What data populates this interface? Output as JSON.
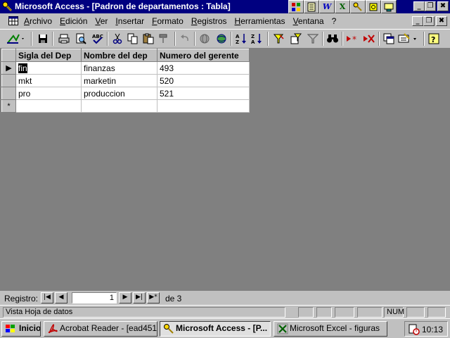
{
  "window": {
    "title": "Microsoft Access - [Padron de departamentos : Tabla]",
    "minimize_glyph": "_",
    "restore_glyph": "❐",
    "close_glyph": "✖"
  },
  "office_bar": [
    {
      "icon": "office-logo-icon"
    },
    {
      "icon": "notepad-icon"
    },
    {
      "icon": "word-icon",
      "glyph": "W"
    },
    {
      "icon": "excel-icon",
      "glyph": "X"
    },
    {
      "icon": "access-key-icon"
    },
    {
      "icon": "binder-icon"
    },
    {
      "icon": "outlook-icon"
    }
  ],
  "menu": {
    "items": [
      "Archivo",
      "Edición",
      "Ver",
      "Insertar",
      "Formato",
      "Registros",
      "Herramientas",
      "Ventana",
      "?"
    ]
  },
  "toolbar": [
    "design-view-icon",
    "save-icon",
    "print-icon",
    "print-preview-icon",
    "spelling-icon",
    "cut-icon",
    "copy-icon",
    "paste-icon",
    "format-painter-icon",
    "undo-icon",
    "insert-hyperlink-icon",
    "web-toolbar-icon",
    "sort-ascending-icon",
    "sort-descending-icon",
    "filter-by-selection-icon",
    "filter-by-form-icon",
    "apply-filter-icon",
    "find-icon",
    "new-record-icon",
    "delete-record-icon",
    "properties-icon",
    "database-window-icon",
    "new-object-icon",
    "help-icon"
  ],
  "table": {
    "columns": [
      "Sigla del Dep",
      "Nombre del dep",
      "Numero del gerente"
    ],
    "rows": [
      [
        "fin",
        "finanzas",
        "493"
      ],
      [
        "mkt",
        "marketin",
        "520"
      ],
      [
        "pro",
        "produccion",
        "521"
      ]
    ],
    "current_row_glyph": "▶",
    "new_row_glyph": "*"
  },
  "navigator": {
    "label": "Registro:",
    "current": "1",
    "of_label": "de 3",
    "first_glyph": "|◀",
    "prev_glyph": "◀",
    "next_glyph": "▶",
    "last_glyph": "▶|",
    "new_glyph": "▶*"
  },
  "status": {
    "text": "Vista Hoja de datos",
    "num": "NUM"
  },
  "taskbar": {
    "start": "Inicio",
    "tasks": [
      {
        "label": "Acrobat Reader - [ead451-...",
        "icon": "acrobat-icon"
      },
      {
        "label": "Microsoft Access - [P...",
        "icon": "access-key-icon",
        "active": true
      },
      {
        "label": "Microsoft Excel - figuras",
        "icon": "excel-icon"
      }
    ],
    "clock": "10:13"
  }
}
